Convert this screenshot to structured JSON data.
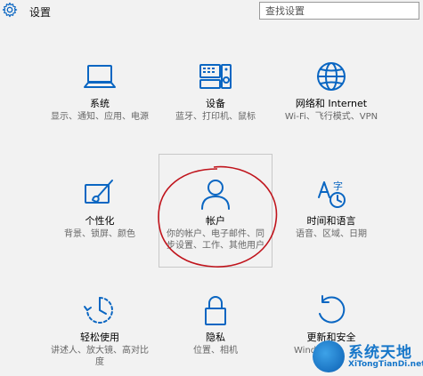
{
  "window": {
    "title": "设置",
    "icon": "gear-icon"
  },
  "search": {
    "placeholder": "查找设置"
  },
  "tiles": [
    {
      "label": "系统",
      "desc": "显示、通知、应用、电源",
      "icon": "laptop-icon"
    },
    {
      "label": "设备",
      "desc": "蓝牙、打印机、鼠标",
      "icon": "keyboard-speaker-icon"
    },
    {
      "label": "网络和 Internet",
      "desc": "Wi-Fi、飞行模式、VPN",
      "icon": "globe-icon"
    },
    {
      "label": "个性化",
      "desc": "背景、锁屏、颜色",
      "icon": "brush-screen-icon"
    },
    {
      "label": "帐户",
      "desc": "你的帐户、电子邮件、同步设置、工作、其他用户",
      "icon": "person-icon",
      "selected": true
    },
    {
      "label": "时间和语言",
      "desc": "语音、区域、日期",
      "icon": "language-clock-icon"
    },
    {
      "label": "轻松使用",
      "desc": "讲述人、放大镜、高对比度",
      "icon": "ease-of-access-icon"
    },
    {
      "label": "隐私",
      "desc": "位置、相机",
      "icon": "lock-icon"
    },
    {
      "label": "更新和安全",
      "desc": "Windows",
      "icon": "sync-icon"
    }
  ],
  "watermark": {
    "title": "系统天地",
    "url": "XiTongTianDi.net"
  },
  "colors": {
    "accent": "#0a66c2",
    "background": "#f2f2f2",
    "annotation": "#c0141c"
  }
}
